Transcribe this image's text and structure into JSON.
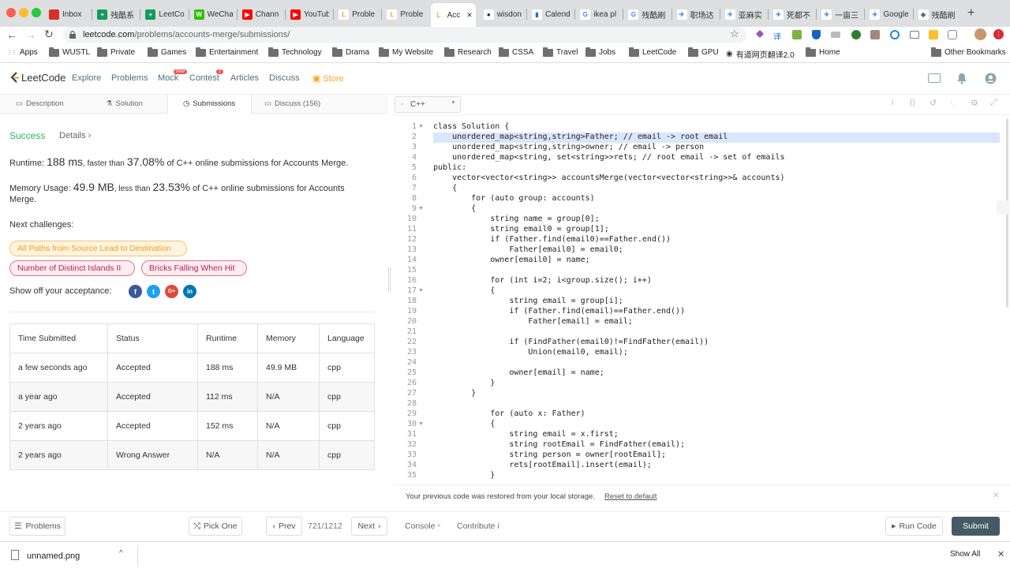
{
  "browser": {
    "tabs": [
      {
        "label": "Inbox",
        "fav": "M",
        "color": "#d93025",
        "text": "#d93025"
      },
      {
        "label": "残酷系",
        "fav": "+",
        "color": "#0f9d58",
        "text": "#fff"
      },
      {
        "label": "LeetCo",
        "fav": "+",
        "color": "#0f9d58",
        "text": "#fff"
      },
      {
        "label": "WeCha",
        "fav": "W",
        "color": "#2dc100",
        "text": "#fff"
      },
      {
        "label": "Chann",
        "fav": "▶",
        "color": "#ff0000",
        "text": "#fff"
      },
      {
        "label": "YouTub",
        "fav": "▶",
        "color": "#ff0000",
        "text": "#fff"
      },
      {
        "label": "Proble",
        "fav": "L",
        "color": "#fff",
        "text": "#f89f1b"
      },
      {
        "label": "Proble",
        "fav": "L",
        "color": "#fff",
        "text": "#f89f1b"
      },
      {
        "label": "Acc",
        "fav": "L",
        "color": "#fff",
        "text": "#f89f1b",
        "active": true
      },
      {
        "label": "wisdon",
        "fav": "●",
        "color": "#fff",
        "text": "#222"
      },
      {
        "label": "Calend",
        "fav": "▮",
        "color": "#fff",
        "text": "#1a73e8"
      },
      {
        "label": "ikea pl",
        "fav": "G",
        "color": "#fff",
        "text": "#4285f4"
      },
      {
        "label": "残酷刷",
        "fav": "G",
        "color": "#fff",
        "text": "#4285f4"
      },
      {
        "label": "职场达",
        "fav": "✈",
        "color": "#fff",
        "text": "#1e88e5"
      },
      {
        "label": "亚麻实",
        "fav": "✈",
        "color": "#fff",
        "text": "#1e88e5"
      },
      {
        "label": "死都不",
        "fav": "✈",
        "color": "#fff",
        "text": "#1e88e5"
      },
      {
        "label": "一亩三",
        "fav": "✈",
        "color": "#fff",
        "text": "#1e88e5"
      },
      {
        "label": "Google",
        "fav": "✈",
        "color": "#fff",
        "text": "#1e88e5"
      },
      {
        "label": "残酷刷",
        "fav": "◆",
        "color": "#fff",
        "text": "#666"
      }
    ],
    "url": "leetcode.com/problems/accounts-merge/submissions/",
    "url_host": "leetcode.com",
    "url_path": "/problems/accounts-merge/submissions/",
    "bookmarks": [
      {
        "label": "Apps",
        "type": "apps"
      },
      {
        "label": "WUSTL",
        "type": "folder"
      },
      {
        "label": "Private",
        "type": "folder"
      },
      {
        "label": "Games",
        "type": "folder"
      },
      {
        "label": "Entertainment",
        "type": "folder"
      },
      {
        "label": "Technology",
        "type": "folder"
      },
      {
        "label": "Drama",
        "type": "folder"
      },
      {
        "label": "My Website",
        "type": "folder"
      },
      {
        "label": "Research",
        "type": "folder"
      },
      {
        "label": "CSSA",
        "type": "folder"
      },
      {
        "label": "Travel",
        "type": "folder"
      },
      {
        "label": "Jobs",
        "type": "folder"
      },
      {
        "label": "LeetCode",
        "type": "folder"
      },
      {
        "label": "GPU",
        "type": "folder"
      },
      {
        "label": "有道网页翻译2.0",
        "type": "globe"
      },
      {
        "label": "Home",
        "type": "folder"
      },
      {
        "label": "Other Bookmarks",
        "type": "folder"
      }
    ]
  },
  "lc": {
    "logo": "LeetCode",
    "nav": [
      "Explore",
      "Problems",
      "Mock",
      "Contest",
      "Articles",
      "Discuss",
      "Store"
    ],
    "mock_badge": "new",
    "contest_badge": "2"
  },
  "left": {
    "tabs": [
      "Description",
      "Solution",
      "Submissions",
      "Discuss (156)"
    ],
    "status": "Success",
    "details": "Details",
    "runtime_label": "Runtime:",
    "runtime_value": "188 ms",
    "runtime_mid": ", faster than",
    "runtime_pct": "37.08%",
    "runtime_tail": "of C++ online submissions for Accounts Merge.",
    "memory_label": "Memory Usage:",
    "memory_value": "49.9 MB",
    "memory_mid": ", less than",
    "memory_pct": "23.53%",
    "memory_tail": "of C++ online submissions for Accounts",
    "memory_tail2": "Merge.",
    "next_label": "Next challenges:",
    "challenges": [
      "All Paths from Source Lead to Destination",
      "Number of Distinct Islands II",
      "Bricks Falling When Hit"
    ],
    "showoff": "Show off your acceptance:",
    "social": [
      "f",
      "t",
      "G+",
      "in"
    ],
    "table_headers": [
      "Time Submitted",
      "Status",
      "Runtime",
      "Memory",
      "Language"
    ],
    "rows": [
      [
        "a few seconds ago",
        "Accepted",
        "188 ms",
        "49.9 MB",
        "cpp"
      ],
      [
        "a year ago",
        "Accepted",
        "112 ms",
        "N/A",
        "cpp"
      ],
      [
        "2 years ago",
        "Accepted",
        "152 ms",
        "N/A",
        "cpp"
      ],
      [
        "2 years ago",
        "Wrong Answer",
        "N/A",
        "N/A",
        "cpp"
      ]
    ]
  },
  "editor": {
    "language": "C++",
    "lines": [
      "class Solution {",
      "    unordered_map<string,string>Father; // email -> root email",
      "    unordered_map<string,string>owner; // email -> person",
      "    unordered_map<string, set<string>>rets; // root email -> set of emails",
      "public:",
      "    vector<vector<string>> accountsMerge(vector<vector<string>>& accounts)",
      "    {",
      "        for (auto group: accounts)",
      "        {",
      "            string name = group[0];",
      "            string email0 = group[1];",
      "            if (Father.find(email0)==Father.end())",
      "                Father[email0] = email0;",
      "            owner[email0] = name;",
      "",
      "            for (int i=2; i<group.size(); i++)",
      "            {",
      "                string email = group[i];",
      "                if (Father.find(email)==Father.end())",
      "                    Father[email] = email;",
      "",
      "                if (FindFather(email0)!=FindFather(email))",
      "                    Union(email0, email);",
      "",
      "                owner[email] = name;",
      "            }",
      "        }",
      "",
      "            for (auto x: Father)",
      "            {",
      "                string email = x.first;",
      "                string rootEmail = FindFather(email);",
      "                string person = owner[rootEmail];",
      "                rets[rootEmail].insert(email);",
      "            }"
    ],
    "restored_msg": "Your previous code was restored from your local storage.",
    "reset_link": "Reset to default"
  },
  "bottom": {
    "problems": "Problems",
    "pick_one": "Pick One",
    "prev": "Prev",
    "page": "721/1212",
    "next": "Next",
    "console": "Console",
    "contribute": "Contribute",
    "run": "Run Code",
    "submit": "Submit"
  },
  "download": {
    "file": "unnamed.png",
    "show_all": "Show All"
  }
}
